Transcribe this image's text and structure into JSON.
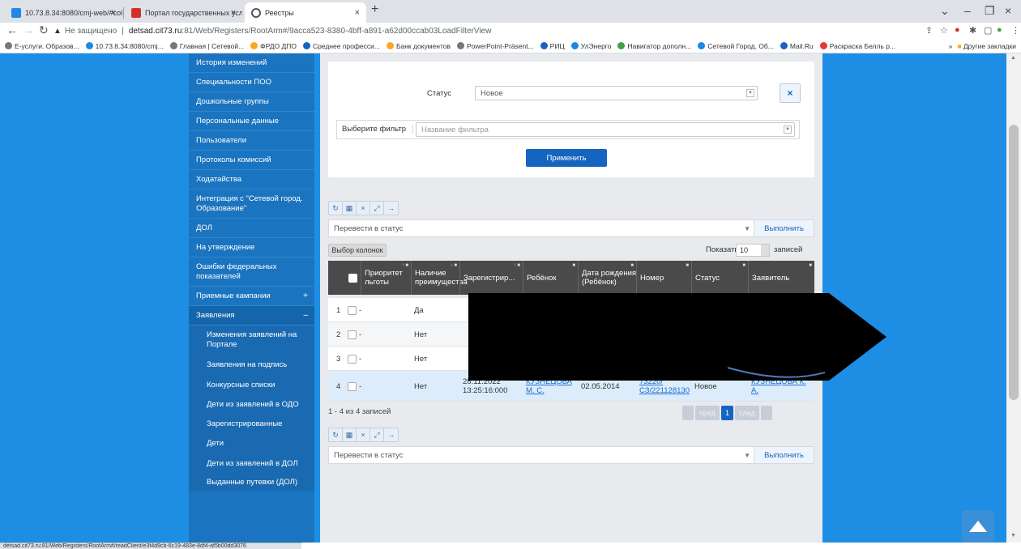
{
  "browser": {
    "tabs": [
      {
        "title": "10.73.8.34:8080/cmj-web/#collec",
        "color": "#1e88e5"
      },
      {
        "title": "Портал государственных услуг",
        "color": "#d32f2f"
      },
      {
        "title": "Реестры",
        "color": "#555555"
      }
    ],
    "url_warning": "Не защищено",
    "url_host": "detsad.cit73.ru",
    "url_path": ":81/Web/Registers/RootArm#/9acca523-8380-4bff-a891-a62d00ccab03LoadFilterView",
    "bookmarks": [
      "Е-услуги. Образов...",
      "10.73.8.34:8080/cmj...",
      "Главная | Сетевой...",
      "ФРДО ДПО",
      "Среднее професси...",
      "Банк документов",
      "PowerPoint-Präsent...",
      "РИЦ",
      "УлЭнерго",
      "Навигатор дополн...",
      "Сетевой Город. Об...",
      "Mail.Ru",
      "Раскраска Белль р..."
    ],
    "bookmarks_more": "»",
    "other_bookmarks": "Другие закладки",
    "status_url": "detsad.cit73.ru:81/Web/Registers/RootArm#/readClient/e3f4d9cb-6c19-483e-8df4-af5b00dd3076"
  },
  "sidebar": {
    "items": [
      {
        "label": "История изменений"
      },
      {
        "label": "Специальности ПОО"
      },
      {
        "label": "Дошкольные группы"
      },
      {
        "label": "Персональные данные"
      },
      {
        "label": "Пользователи"
      },
      {
        "label": "Протоколы комиссий"
      },
      {
        "label": "Ходатайства"
      },
      {
        "label": "Интеграция с \"Сетевой город. Образование\""
      },
      {
        "label": "ДОЛ"
      },
      {
        "label": "На утверждение"
      },
      {
        "label": "Ошибки федеральных показателей"
      },
      {
        "label": "Приемные кампании",
        "marker": "+"
      },
      {
        "label": "Заявления",
        "marker": "–"
      }
    ],
    "subitems": [
      {
        "label": "Изменения заявлений на Портале"
      },
      {
        "label": "Заявления на подпись"
      },
      {
        "label": "Конкурсные списки"
      },
      {
        "label": "Дети из заявлений в ОДО"
      },
      {
        "label": "Зарегистрированные"
      },
      {
        "label": "Дети"
      },
      {
        "label": "Дети из заявлений в ДОЛ"
      },
      {
        "label": "Выданные путевки (ДОЛ)"
      }
    ]
  },
  "filter": {
    "status_label": "Статус",
    "status_value": "Новое",
    "clear_label": "×",
    "filter_label": "Выберите фильтр",
    "filter_placeholder": "Название фильтра",
    "apply_label": "Применить"
  },
  "toolbar": {
    "transfer_label": "Перевести в статус",
    "execute_label": "Выполнить",
    "columns_label": "Выбор колонок",
    "show_label": "Показать",
    "show_value": "10",
    "records_suffix": "записей"
  },
  "table": {
    "columns": [
      "Приоритет льготы",
      "Наличие преимущества",
      "Зарегистрир...",
      "Ребёнок",
      "Дата рождения (Ребёнок)",
      "Номер",
      "Статус",
      "Заявитель"
    ],
    "rows": [
      {
        "n": "1",
        "priority": "-",
        "advantage": "Да",
        "registered": "",
        "child": "",
        "birth": "",
        "number": "",
        "status": "",
        "applicant": ""
      },
      {
        "n": "2",
        "priority": "-",
        "advantage": "Нет",
        "registered": "",
        "child": "",
        "birth": "",
        "number": "",
        "status": "",
        "applicant": ""
      },
      {
        "n": "3",
        "priority": "-",
        "advantage": "Нет",
        "registered": "",
        "child": "",
        "birth": "",
        "number": "",
        "status": "",
        "applicant": ""
      },
      {
        "n": "4",
        "priority": "-",
        "advantage": "Нет",
        "registered": "28.11.2022 13:25:16:000",
        "child": "КУЗНЕЦОВА М. С.",
        "birth": "02.05.2014",
        "number": "73220/ СЗ/221128130",
        "status": "Новое",
        "applicant": "КУЗНЕЦОВА К. А."
      }
    ],
    "footer": "1 - 4 из 4 записей",
    "pager": {
      "prev": "пред",
      "page": "1",
      "next": "след"
    }
  },
  "colors": {
    "page_bg": "#1e8ee4",
    "sidebar_bg": "#1b74bf",
    "primary": "#1565c0",
    "header_bg": "#4a4a4a"
  }
}
